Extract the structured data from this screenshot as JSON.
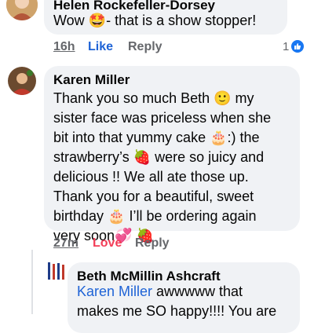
{
  "comments": [
    {
      "author": "Helen Rockefeller-Dorsey",
      "text_before": "Wow ",
      "emoji": "🤩",
      "text_after": "- that is a show stopper!",
      "time": "16h",
      "like_label": "Like",
      "reply_label": "Reply",
      "reaction_count": "1"
    },
    {
      "author": "Karen Miller",
      "lines": [
        "Thank you so much Beth 🙂 my",
        "sister face was priceless when she",
        "bit into that yummy cake 🎂:) the",
        "strawberry’s 🍓 were so juicy and",
        "delicious !! We all ate those up.",
        "Thank you for a beautiful, sweet",
        "birthday 🎂 I’ll be ordering again",
        "very soon💞 🍓"
      ],
      "time": "27m",
      "love_label": "Love",
      "reply_label": "Reply"
    },
    {
      "author": "Beth McMillin Ashcraft",
      "mention": "Karen Miller",
      "line1_rest": " awwwww that",
      "line2": "makes me SO happy!!!!  You are"
    }
  ],
  "colors": {
    "bubble": "#f0f2f5",
    "link": "#1e63d6",
    "love": "#f33e58",
    "meta": "#65676b",
    "like_badge": "#1877f2"
  },
  "icons": [
    "avatar",
    "like-badge-icon",
    "thumbs-up-icon"
  ]
}
